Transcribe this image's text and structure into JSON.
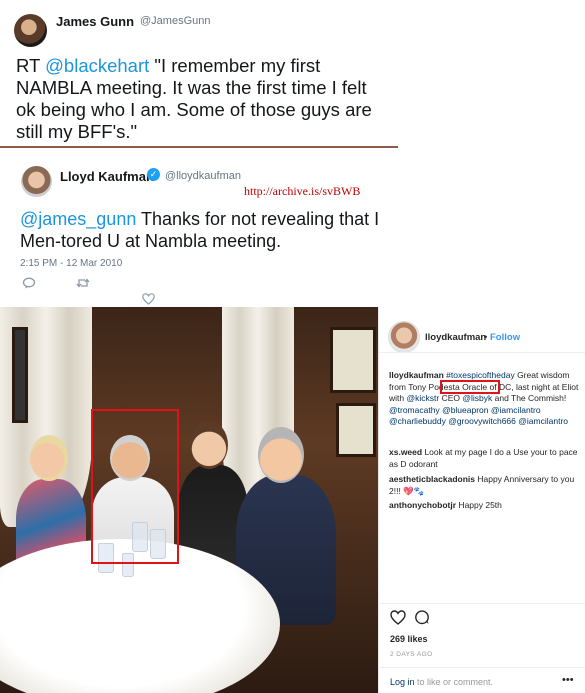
{
  "tweet1": {
    "author_name": "James Gunn",
    "author_handle": "@JamesGunn",
    "text_prefix": "RT ",
    "mention": "@blackehart",
    "text_body": " \"I remember my first NAMBLA meeting. It was the first time I felt ok being who I am. Some of those guys are still my BFF's.\""
  },
  "tweet2": {
    "author_name": "Lloyd Kaufman",
    "verified_glyph": "✓",
    "author_handle": "@lloydkaufman",
    "archive_url": "http://archive.is/svBWB",
    "mention": "@james_gunn",
    "text_body": " Thanks for not revealing that I Men-tored U at Nambla meeting.",
    "timestamp": "2:15 PM - 12 Mar 2010",
    "icons": {
      "reply": "reply-icon",
      "retweet": "retweet-icon",
      "like": "heart-icon"
    }
  },
  "instagram": {
    "username": "lloydkaufman",
    "dot": "•",
    "follow_label": "Follow",
    "caption": {
      "user": "lloydkaufman",
      "hashtag": "#toxespicoftheday",
      "t1": " Great wisdom from ",
      "podesta": "Tony Podesta",
      "t2": " Oracle of DC, last night at Eliot with ",
      "mention1": "@kickstr",
      "t3": " CEO ",
      "mention2": "@lisbyk",
      "t4": " and The Commish! ",
      "mention3": "@tromacathy",
      "t5": " ",
      "mention4": "@blueapron",
      "t6": " ",
      "mention5": "@iamcilantro",
      "t7": " ",
      "mention6": "@charliebuddy",
      "t8": " ",
      "mention7": "@groovywitch666",
      "t9": " ",
      "mention8": "@iamcilantro"
    },
    "comments": [
      {
        "user": "xs.weed",
        "text": " Look at my page I do a Use your to pace as D odorant"
      },
      {
        "user": "aestheticblackadonis",
        "text": " Happy Anniversary to you 2!!! 💖🐾"
      },
      {
        "user": "anthonychobotjr",
        "text": " Happy 25th"
      }
    ],
    "likes": "269 likes",
    "date": "2 DAYS AGO",
    "login_link": "Log in",
    "login_text": " to like or comment.",
    "more_glyph": "•••",
    "icons": {
      "like": "heart-icon",
      "comment": "comment-icon"
    }
  }
}
